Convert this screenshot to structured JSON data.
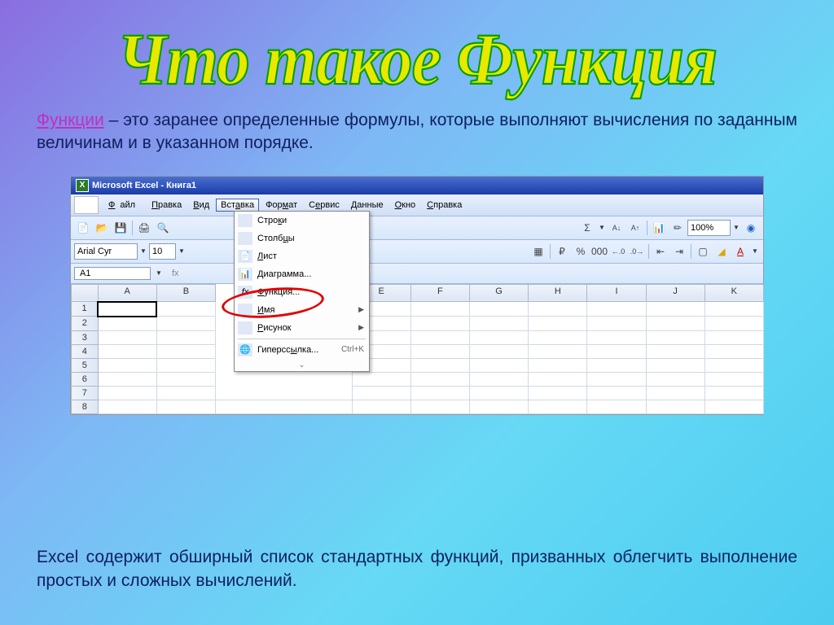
{
  "title": "Что такое Функция",
  "para1_term": "Функции",
  "para1_rest": " – это заранее определенные формулы, которые выполняют вычисления по заданным величинам и в указанном порядке.",
  "para2": "Excel содержит обширный список стандартных функций, призванных облегчить выполнение простых и сложных вычислений.",
  "excel": {
    "titlebar": "Microsoft Excel - Книга1",
    "menu": {
      "file": "Файл",
      "edit": "Правка",
      "view": "Вид",
      "insert": "Вставка",
      "format": "Формат",
      "tools": "Сервис",
      "data": "Данные",
      "window": "Окно",
      "help": "Справка"
    },
    "font": "Arial Cyr",
    "fontsize": "10",
    "zoom": "100%",
    "cellref": "A1",
    "cols": [
      "A",
      "B",
      "E",
      "F",
      "G",
      "H",
      "I",
      "J",
      "K"
    ],
    "rows": [
      "1",
      "2",
      "3",
      "4",
      "5",
      "6",
      "7",
      "8"
    ],
    "dropdown": {
      "rows": "Строки",
      "cols": "Столбцы",
      "sheet": "Лист",
      "chart": "Диаграмма...",
      "func": "Функция...",
      "name": "Имя",
      "pic": "Рисунок",
      "hyper": "Гиперссылка...",
      "hyper_sc": "Ctrl+K"
    }
  }
}
